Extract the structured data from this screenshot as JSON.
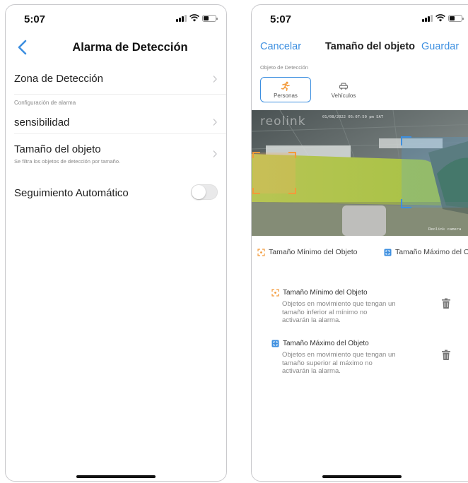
{
  "left": {
    "time": "5:07",
    "title": "Alarma de Detección",
    "detection_zone": "Zona de Detección",
    "alarm_config_header": "Configuración de alarma",
    "sensitivity": "sensibilidad",
    "object_size": "Tamaño del objeto",
    "object_size_sub": "Se filtra los objetos de detección por tamaño.",
    "auto_tracking": "Seguimiento Automático",
    "auto_tracking_on": false
  },
  "right": {
    "time": "5:07",
    "cancel": "Cancelar",
    "title": "Tamaño del objeto",
    "save": "Guardar",
    "detection_object_label": "Objeto de Detección",
    "segments": [
      {
        "label": "Personas",
        "selected": true
      },
      {
        "label": "Vehículos",
        "selected": false
      }
    ],
    "camera": {
      "watermark": "reolink",
      "timestamp": "01/08/2022 05:07:50 pm SAT",
      "corner_label": "Reolink camera"
    },
    "legend": {
      "min": "Tamaño Mínimo del Objeto",
      "max": "Tamaño Máximo del Objeto"
    },
    "info": [
      {
        "title": "Tamaño Mínimo del Objeto",
        "lines": [
          "Objetos en movimiento que tengan un",
          "tamaño inferior al mínimo no",
          "activarán la alarma."
        ]
      },
      {
        "title": "Tamaño Máximo del Objeto",
        "lines": [
          "Objetos en movimiento que tengan un",
          "tamaño superior al máximo no",
          "activarán la alarma."
        ]
      }
    ]
  },
  "colors": {
    "accent": "#3d8fe0",
    "min_box": "#f39a3a",
    "max_box": "#3d8fe0"
  }
}
